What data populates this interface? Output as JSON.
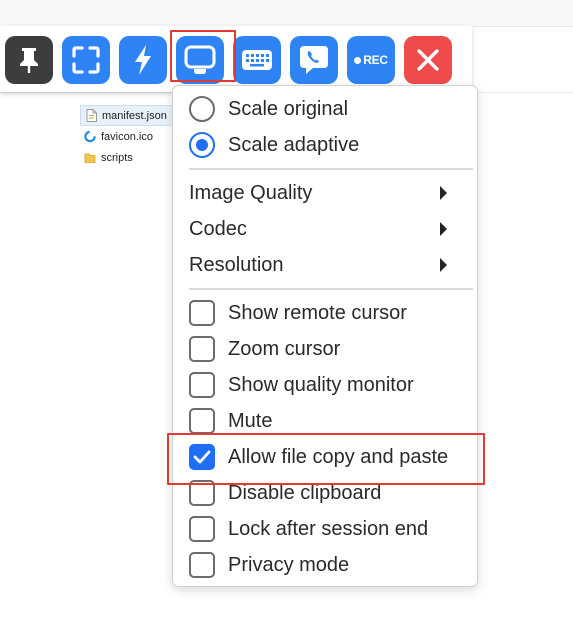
{
  "explorer": {
    "files": [
      {
        "name": "manifest.json",
        "icon": "json-file-icon"
      },
      {
        "name": "favicon.ico",
        "icon": "favicon-icon"
      },
      {
        "name": "scripts",
        "icon": "folder-icon"
      }
    ]
  },
  "toolbar": {
    "buttons": [
      {
        "id": "pin",
        "icon": "pin-icon",
        "color": "#3d3d3d"
      },
      {
        "id": "fullscreen",
        "icon": "fullscreen-icon",
        "color": "#2f84f5"
      },
      {
        "id": "actions",
        "icon": "lightning-icon",
        "color": "#2f84f5"
      },
      {
        "id": "display",
        "icon": "monitor-icon",
        "color": "#2f84f5"
      },
      {
        "id": "keyboard",
        "icon": "keyboard-icon",
        "color": "#2f84f5"
      },
      {
        "id": "chat",
        "icon": "chat-phone-icon",
        "color": "#2f84f5"
      },
      {
        "id": "record",
        "icon": "record-icon",
        "color": "#2f84f5",
        "label": "REC"
      },
      {
        "id": "close",
        "icon": "close-icon",
        "color": "#f04b4b"
      }
    ]
  },
  "menu": {
    "scale": [
      {
        "label": "Scale original",
        "selected": false
      },
      {
        "label": "Scale adaptive",
        "selected": true
      }
    ],
    "submenus": [
      {
        "label": "Image Quality"
      },
      {
        "label": "Codec"
      },
      {
        "label": "Resolution"
      }
    ],
    "toggles": [
      {
        "label": "Show remote cursor",
        "checked": false
      },
      {
        "label": "Zoom cursor",
        "checked": false
      },
      {
        "label": "Show quality monitor",
        "checked": false
      },
      {
        "label": "Mute",
        "checked": false
      },
      {
        "label": "Allow file copy and paste",
        "checked": true
      },
      {
        "label": "Disable clipboard",
        "checked": false
      },
      {
        "label": "Lock after session end",
        "checked": false
      },
      {
        "label": "Privacy mode",
        "checked": false
      }
    ]
  },
  "colors": {
    "accent": "#1e6ff5",
    "highlight": "#e53935"
  }
}
